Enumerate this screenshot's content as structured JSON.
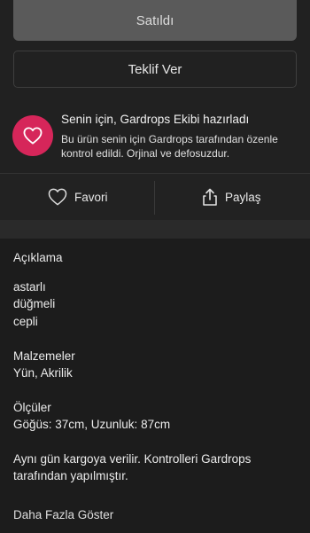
{
  "buttons": {
    "sold_label": "Satıldı",
    "offer_label": "Teklif Ver"
  },
  "curated": {
    "icon": "heart-icon",
    "title": "Senin için, Gardrops Ekibi hazırladı",
    "description": "Bu ürün senin için Gardrops tarafından özenle kontrol edildi. Orjinal ve defosuzdur.",
    "badge_color": "#d6265a"
  },
  "actions": {
    "favorite_label": "Favori",
    "favorite_icon": "heart-outline-icon",
    "share_label": "Paylaş",
    "share_icon": "share-icon"
  },
  "description": {
    "section_title": "Açıklama",
    "lines": [
      "astarlı",
      "düğmeli",
      "cepli",
      "",
      "Malzemeler",
      "Yün, Akrilik",
      "",
      "Ölçüler",
      "Göğüs: 37cm, Uzunluk: 87cm",
      "",
      "Aynı gün kargoya verilir. Kontrolleri Gardrops",
      "tarafından yapılmıştır."
    ],
    "show_more_label": "Daha Fazla Göster"
  }
}
